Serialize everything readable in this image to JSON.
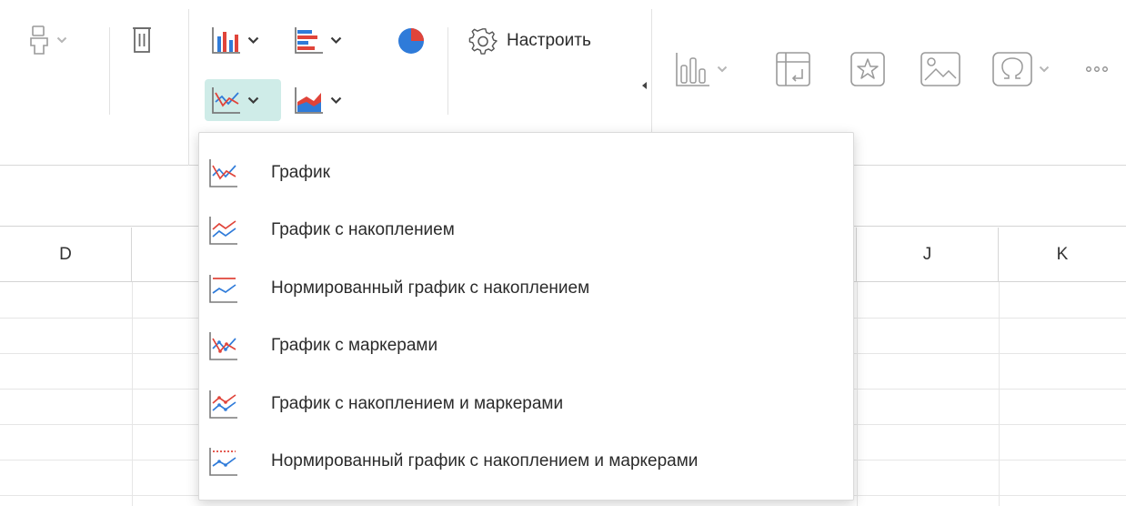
{
  "ribbon": {
    "customize_label": "Настроить",
    "icons": [
      "format-painter-icon",
      "delete-icon",
      "column-chart-icon",
      "bar-chart-icon",
      "pie-chart-icon",
      "line-chart-icon",
      "area-chart-icon",
      "settings-icon",
      "sparkline-icon",
      "pivot-table-icon",
      "star-icon",
      "image-icon",
      "symbol-omega-icon",
      "more-icon"
    ],
    "active_button": "line-chart-button"
  },
  "columns": {
    "d": "D",
    "j": "J",
    "k": "K"
  },
  "menu": {
    "items": [
      {
        "label": "График",
        "icon": "line-chart-icon"
      },
      {
        "label": "График с накоплением",
        "icon": "stacked-line-chart-icon"
      },
      {
        "label": "Нормированный график с накоплением",
        "icon": "percent-stacked-line-chart-icon"
      },
      {
        "label": "График с маркерами",
        "icon": "line-chart-markers-icon"
      },
      {
        "label": "График с накоплением и маркерами",
        "icon": "stacked-line-chart-markers-icon"
      },
      {
        "label": "Нормированный график с накоплением и маркерами",
        "icon": "percent-stacked-line-chart-markers-icon"
      }
    ]
  },
  "colors": {
    "accent_teal": "#cfece8",
    "chart_blue": "#2f7bd9",
    "chart_red": "#e0443a",
    "icon_gray": "#8a8a8a"
  }
}
